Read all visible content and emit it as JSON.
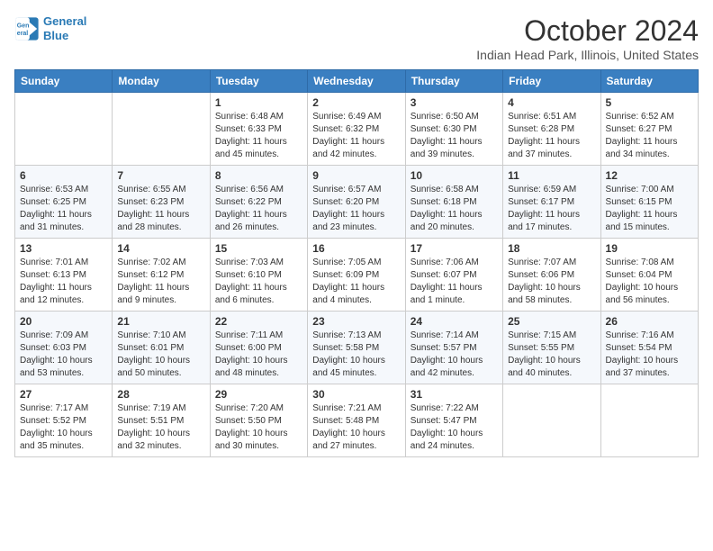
{
  "header": {
    "logo_line1": "General",
    "logo_line2": "Blue",
    "month": "October 2024",
    "location": "Indian Head Park, Illinois, United States"
  },
  "columns": [
    "Sunday",
    "Monday",
    "Tuesday",
    "Wednesday",
    "Thursday",
    "Friday",
    "Saturday"
  ],
  "weeks": [
    [
      {
        "num": "",
        "info": ""
      },
      {
        "num": "",
        "info": ""
      },
      {
        "num": "1",
        "info": "Sunrise: 6:48 AM\nSunset: 6:33 PM\nDaylight: 11 hours and 45 minutes."
      },
      {
        "num": "2",
        "info": "Sunrise: 6:49 AM\nSunset: 6:32 PM\nDaylight: 11 hours and 42 minutes."
      },
      {
        "num": "3",
        "info": "Sunrise: 6:50 AM\nSunset: 6:30 PM\nDaylight: 11 hours and 39 minutes."
      },
      {
        "num": "4",
        "info": "Sunrise: 6:51 AM\nSunset: 6:28 PM\nDaylight: 11 hours and 37 minutes."
      },
      {
        "num": "5",
        "info": "Sunrise: 6:52 AM\nSunset: 6:27 PM\nDaylight: 11 hours and 34 minutes."
      }
    ],
    [
      {
        "num": "6",
        "info": "Sunrise: 6:53 AM\nSunset: 6:25 PM\nDaylight: 11 hours and 31 minutes."
      },
      {
        "num": "7",
        "info": "Sunrise: 6:55 AM\nSunset: 6:23 PM\nDaylight: 11 hours and 28 minutes."
      },
      {
        "num": "8",
        "info": "Sunrise: 6:56 AM\nSunset: 6:22 PM\nDaylight: 11 hours and 26 minutes."
      },
      {
        "num": "9",
        "info": "Sunrise: 6:57 AM\nSunset: 6:20 PM\nDaylight: 11 hours and 23 minutes."
      },
      {
        "num": "10",
        "info": "Sunrise: 6:58 AM\nSunset: 6:18 PM\nDaylight: 11 hours and 20 minutes."
      },
      {
        "num": "11",
        "info": "Sunrise: 6:59 AM\nSunset: 6:17 PM\nDaylight: 11 hours and 17 minutes."
      },
      {
        "num": "12",
        "info": "Sunrise: 7:00 AM\nSunset: 6:15 PM\nDaylight: 11 hours and 15 minutes."
      }
    ],
    [
      {
        "num": "13",
        "info": "Sunrise: 7:01 AM\nSunset: 6:13 PM\nDaylight: 11 hours and 12 minutes."
      },
      {
        "num": "14",
        "info": "Sunrise: 7:02 AM\nSunset: 6:12 PM\nDaylight: 11 hours and 9 minutes."
      },
      {
        "num": "15",
        "info": "Sunrise: 7:03 AM\nSunset: 6:10 PM\nDaylight: 11 hours and 6 minutes."
      },
      {
        "num": "16",
        "info": "Sunrise: 7:05 AM\nSunset: 6:09 PM\nDaylight: 11 hours and 4 minutes."
      },
      {
        "num": "17",
        "info": "Sunrise: 7:06 AM\nSunset: 6:07 PM\nDaylight: 11 hours and 1 minute."
      },
      {
        "num": "18",
        "info": "Sunrise: 7:07 AM\nSunset: 6:06 PM\nDaylight: 10 hours and 58 minutes."
      },
      {
        "num": "19",
        "info": "Sunrise: 7:08 AM\nSunset: 6:04 PM\nDaylight: 10 hours and 56 minutes."
      }
    ],
    [
      {
        "num": "20",
        "info": "Sunrise: 7:09 AM\nSunset: 6:03 PM\nDaylight: 10 hours and 53 minutes."
      },
      {
        "num": "21",
        "info": "Sunrise: 7:10 AM\nSunset: 6:01 PM\nDaylight: 10 hours and 50 minutes."
      },
      {
        "num": "22",
        "info": "Sunrise: 7:11 AM\nSunset: 6:00 PM\nDaylight: 10 hours and 48 minutes."
      },
      {
        "num": "23",
        "info": "Sunrise: 7:13 AM\nSunset: 5:58 PM\nDaylight: 10 hours and 45 minutes."
      },
      {
        "num": "24",
        "info": "Sunrise: 7:14 AM\nSunset: 5:57 PM\nDaylight: 10 hours and 42 minutes."
      },
      {
        "num": "25",
        "info": "Sunrise: 7:15 AM\nSunset: 5:55 PM\nDaylight: 10 hours and 40 minutes."
      },
      {
        "num": "26",
        "info": "Sunrise: 7:16 AM\nSunset: 5:54 PM\nDaylight: 10 hours and 37 minutes."
      }
    ],
    [
      {
        "num": "27",
        "info": "Sunrise: 7:17 AM\nSunset: 5:52 PM\nDaylight: 10 hours and 35 minutes."
      },
      {
        "num": "28",
        "info": "Sunrise: 7:19 AM\nSunset: 5:51 PM\nDaylight: 10 hours and 32 minutes."
      },
      {
        "num": "29",
        "info": "Sunrise: 7:20 AM\nSunset: 5:50 PM\nDaylight: 10 hours and 30 minutes."
      },
      {
        "num": "30",
        "info": "Sunrise: 7:21 AM\nSunset: 5:48 PM\nDaylight: 10 hours and 27 minutes."
      },
      {
        "num": "31",
        "info": "Sunrise: 7:22 AM\nSunset: 5:47 PM\nDaylight: 10 hours and 24 minutes."
      },
      {
        "num": "",
        "info": ""
      },
      {
        "num": "",
        "info": ""
      }
    ]
  ]
}
